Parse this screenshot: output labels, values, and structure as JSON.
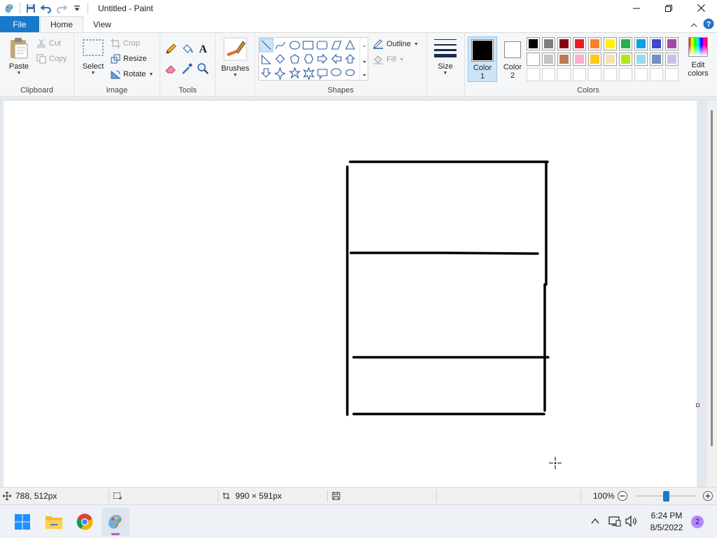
{
  "window": {
    "title": "Untitled - Paint"
  },
  "tabs": {
    "file": "File",
    "home": "Home",
    "view": "View"
  },
  "ribbon": {
    "clipboard": {
      "label": "Clipboard",
      "paste": "Paste",
      "cut": "Cut",
      "copy": "Copy"
    },
    "image": {
      "label": "Image",
      "select": "Select",
      "crop": "Crop",
      "resize": "Resize",
      "rotate": "Rotate"
    },
    "tools": {
      "label": "Tools"
    },
    "brushes": {
      "label": "Brushes"
    },
    "shapes": {
      "label": "Shapes",
      "outline": "Outline",
      "fill": "Fill"
    },
    "size": {
      "label": "Size"
    },
    "colors": {
      "label": "Colors",
      "color1_line1": "Color",
      "color1_line2": "1",
      "color2_line1": "Color",
      "color2_line2": "2",
      "edit_line1": "Edit",
      "edit_line2": "colors",
      "color1_value": "#000000",
      "color2_value": "#ffffff",
      "palette_row1": [
        "#000000",
        "#7f7f7f",
        "#880015",
        "#ed1c24",
        "#ff7f27",
        "#fff200",
        "#22b14c",
        "#00a2e8",
        "#3f48cc",
        "#a349a4"
      ],
      "palette_row2": [
        "#ffffff",
        "#c3c3c3",
        "#b97a57",
        "#ffaec9",
        "#ffc90e",
        "#efe4b0",
        "#b5e61d",
        "#99d9ea",
        "#7092be",
        "#c8bfe7"
      ]
    }
  },
  "status": {
    "cursor_pos": "788, 512px",
    "canvas_size": "990 × 591px",
    "zoom": "100%",
    "zoom_level": 0.5
  },
  "taskbar": {
    "time": "6:24 PM",
    "date": "8/5/2022",
    "notifications": "2"
  }
}
